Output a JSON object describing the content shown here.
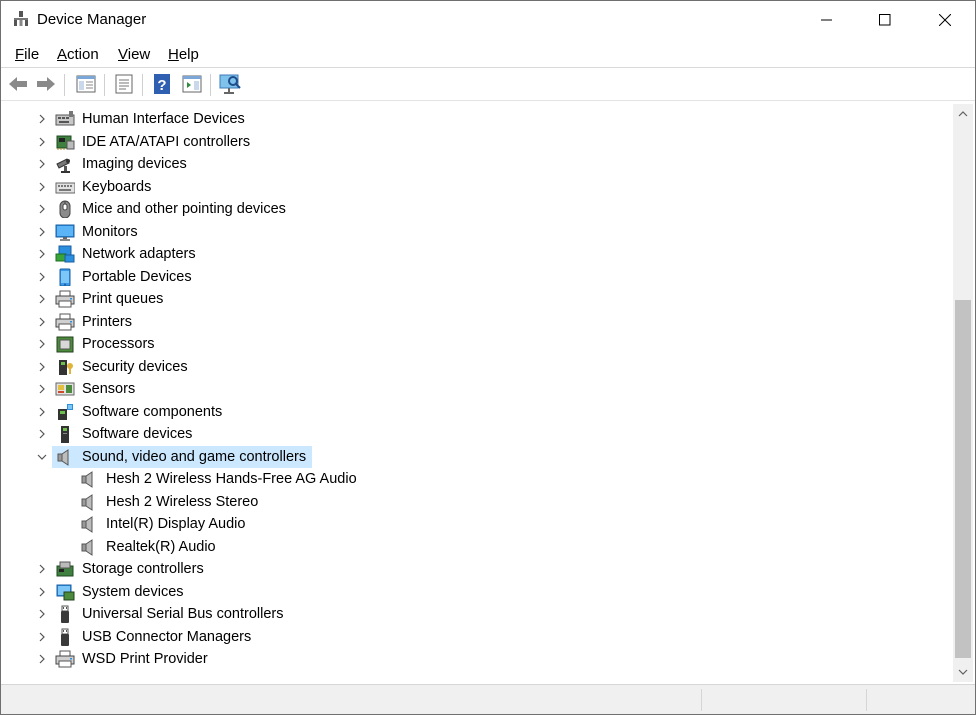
{
  "window": {
    "title": "Device Manager",
    "controls": {
      "minimize": "minimize-icon",
      "maximize": "maximize-icon",
      "close": "close-icon"
    }
  },
  "menu": [
    {
      "label": "File",
      "key": "F",
      "rest": "ile"
    },
    {
      "label": "Action",
      "key": "A",
      "rest": "ction"
    },
    {
      "label": "View",
      "key": "V",
      "rest": "iew"
    },
    {
      "label": "Help",
      "key": "H",
      "rest": "elp"
    }
  ],
  "toolbar": {
    "icons": [
      "back-arrow-icon",
      "forward-arrow-icon",
      "show-hide-console-tree-icon",
      "properties-icon",
      "help-icon",
      "action-pane-icon",
      "scan-hardware-icon"
    ]
  },
  "tree": {
    "selected_color": "#cce8ff",
    "categories": [
      {
        "label": "Human Interface Devices",
        "icon": "hid-icon",
        "expanded": false
      },
      {
        "label": "IDE ATA/ATAPI controllers",
        "icon": "ide-controller-icon",
        "expanded": false
      },
      {
        "label": "Imaging devices",
        "icon": "camera-icon",
        "expanded": false
      },
      {
        "label": "Keyboards",
        "icon": "keyboard-icon",
        "expanded": false
      },
      {
        "label": "Mice and other pointing devices",
        "icon": "mouse-icon",
        "expanded": false
      },
      {
        "label": "Monitors",
        "icon": "monitor-icon",
        "expanded": false
      },
      {
        "label": "Network adapters",
        "icon": "network-adapter-icon",
        "expanded": false
      },
      {
        "label": "Portable Devices",
        "icon": "portable-device-icon",
        "expanded": false
      },
      {
        "label": "Print queues",
        "icon": "printer-icon",
        "expanded": false
      },
      {
        "label": "Printers",
        "icon": "printer-icon",
        "expanded": false
      },
      {
        "label": "Processors",
        "icon": "processor-icon",
        "expanded": false
      },
      {
        "label": "Security devices",
        "icon": "security-device-icon",
        "expanded": false
      },
      {
        "label": "Sensors",
        "icon": "sensor-icon",
        "expanded": false
      },
      {
        "label": "Software components",
        "icon": "software-component-icon",
        "expanded": false
      },
      {
        "label": "Software devices",
        "icon": "software-device-icon",
        "expanded": false
      },
      {
        "label": "Sound, video and game controllers",
        "icon": "speaker-icon",
        "expanded": true,
        "selected": true,
        "children": [
          {
            "label": "Hesh 2 Wireless Hands-Free AG Audio",
            "icon": "speaker-icon"
          },
          {
            "label": "Hesh 2 Wireless Stereo",
            "icon": "speaker-icon"
          },
          {
            "label": "Intel(R) Display Audio",
            "icon": "speaker-icon"
          },
          {
            "label": "Realtek(R) Audio",
            "icon": "speaker-icon"
          }
        ]
      },
      {
        "label": "Storage controllers",
        "icon": "storage-controller-icon",
        "expanded": false
      },
      {
        "label": "System devices",
        "icon": "system-device-icon",
        "expanded": false
      },
      {
        "label": "Universal Serial Bus controllers",
        "icon": "usb-icon",
        "expanded": false
      },
      {
        "label": "USB Connector Managers",
        "icon": "usb-icon",
        "expanded": false
      },
      {
        "label": "WSD Print Provider",
        "icon": "printer-icon",
        "expanded": false
      }
    ]
  }
}
